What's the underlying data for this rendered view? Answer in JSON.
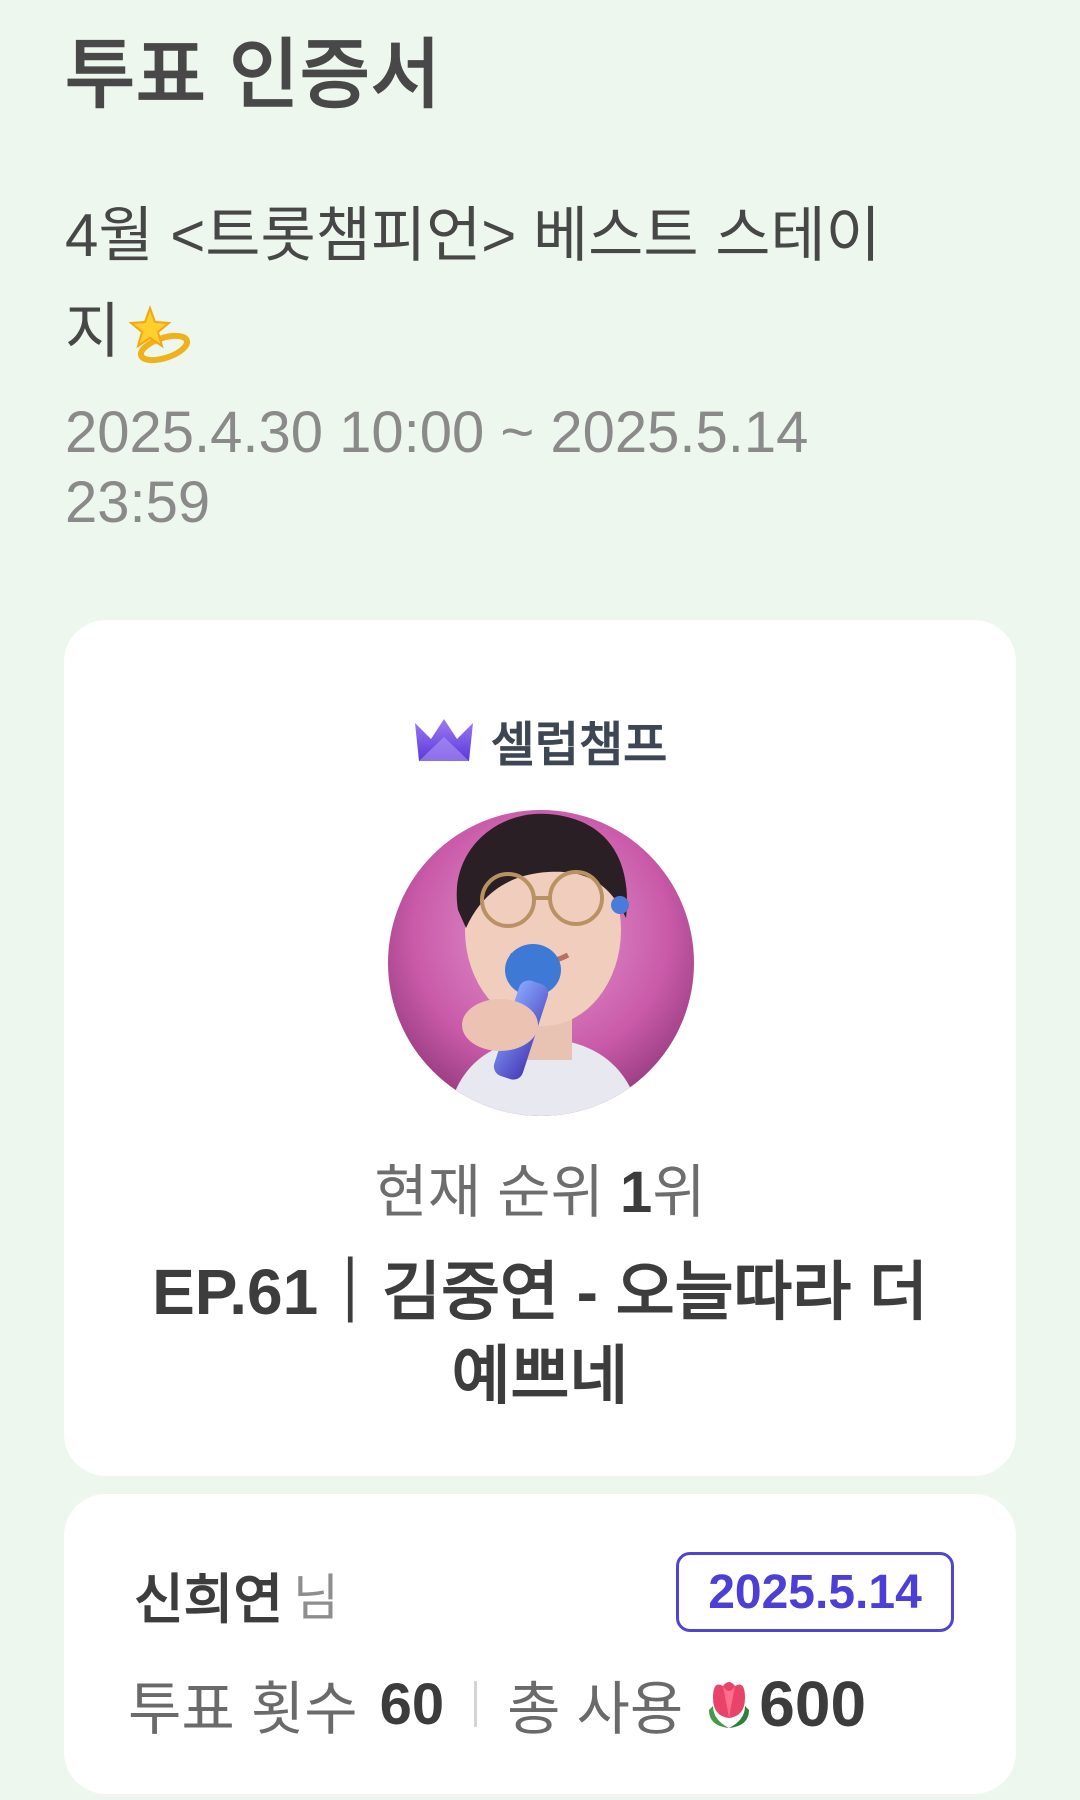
{
  "page": {
    "title": "투표 인증서"
  },
  "vote": {
    "title": "4월 <트롯챔피언> 베스트 스테이지",
    "period_line1": "2025.4.30 10:00 ~ 2025.5.14",
    "period_line2": "23:59"
  },
  "brand": {
    "name": "셀럽챔프",
    "icon": "crown-icon",
    "icon_color": "#7b4fe8"
  },
  "result": {
    "rank_prefix": "현재 순위",
    "rank_value": "1",
    "rank_suffix": "위",
    "song_line1": "EP.61｜김중연 - 오늘따라 더",
    "song_line2": "예쁘네"
  },
  "voter": {
    "name": "신희연",
    "suffix": "님",
    "date": "2025.5.14",
    "vote_count_label": "투표 횟수",
    "vote_count": "60",
    "total_used_label": "총 사용",
    "total_used": "600",
    "currency_icon": "tulip-icon"
  },
  "colors": {
    "background": "#eef7ee",
    "accent": "#5144d4",
    "card": "#ffffff"
  }
}
